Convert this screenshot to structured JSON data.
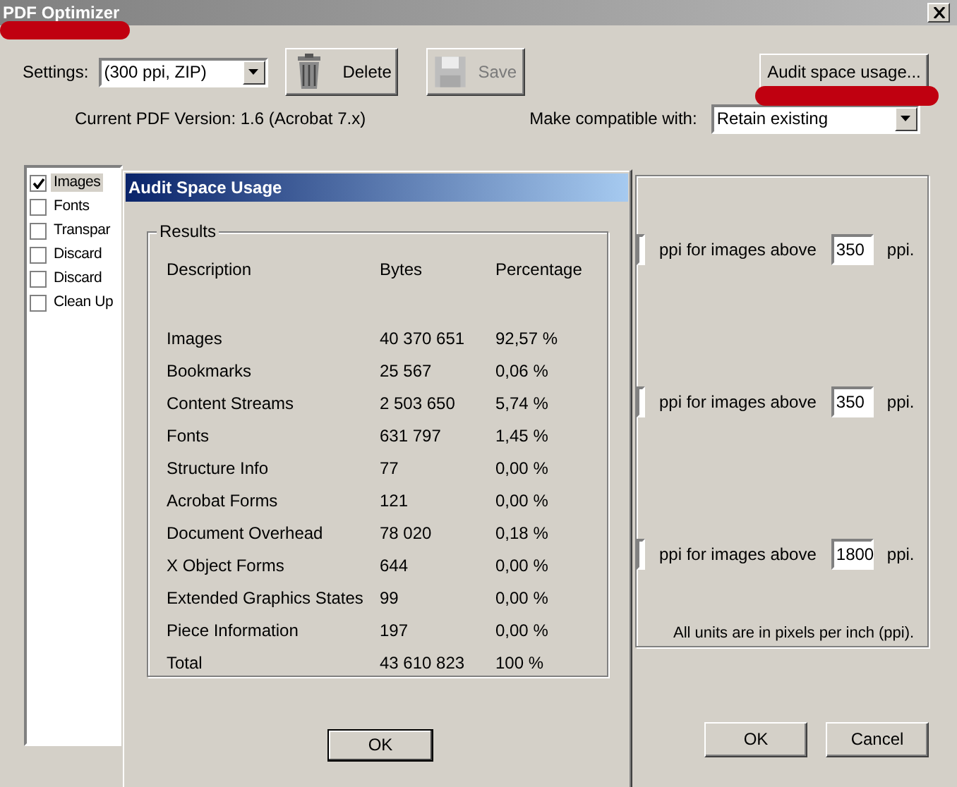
{
  "window": {
    "title": "PDF Optimizer"
  },
  "settings": {
    "label": "Settings:",
    "value": "(300 ppi, ZIP)"
  },
  "toolbar": [
    {
      "kind": "delete",
      "label": "Delete",
      "disabled": false
    },
    {
      "kind": "save",
      "label": "Save",
      "disabled": true
    }
  ],
  "audit_button": "Audit space usage...",
  "version": "Current PDF Version: 1.6 (Acrobat 7.x)",
  "compat": {
    "label": "Make compatible with:",
    "value": "Retain existing"
  },
  "panels": [
    {
      "label": "Images",
      "checked": true,
      "selected": true
    },
    {
      "label": "Fonts",
      "checked": false,
      "selected": false
    },
    {
      "label": "Transpar",
      "checked": false,
      "selected": false
    },
    {
      "label": "Discard",
      "checked": false,
      "selected": false
    },
    {
      "label": "Discard",
      "checked": false,
      "selected": false
    },
    {
      "label": "Clean Up",
      "checked": false,
      "selected": false
    }
  ],
  "image_rows": [
    {
      "text": "ppi for images above",
      "threshold": "350",
      "unit": "ppi."
    },
    {
      "text": "ppi for images above",
      "threshold": "350",
      "unit": "ppi."
    },
    {
      "text": "ppi for images above",
      "threshold": "1800",
      "unit": "ppi."
    }
  ],
  "note": "All units are in pixels per inch (ppi).",
  "footer_buttons": [
    "OK",
    "Cancel"
  ],
  "audit_dialog": {
    "title": "Audit Space Usage",
    "group": "Results",
    "columns": [
      "Description",
      "Bytes",
      "Percentage"
    ],
    "rows": [
      [
        "Images",
        "40 370 651",
        "92,57 %"
      ],
      [
        "Bookmarks",
        "25 567",
        "0,06 %"
      ],
      [
        "Content Streams",
        "2 503 650",
        "5,74 %"
      ],
      [
        "Fonts",
        "631 797",
        "1,45 %"
      ],
      [
        "Structure Info",
        "77",
        "0,00 %"
      ],
      [
        "Acrobat Forms",
        "121",
        "0,00 %"
      ],
      [
        "Document Overhead",
        "78 020",
        "0,18 %"
      ],
      [
        "X Object Forms",
        "644",
        "0,00 %"
      ],
      [
        "Extended Graphics States",
        "99",
        "0,00 %"
      ],
      [
        "Piece Information",
        "197",
        "0,00 %"
      ],
      [
        "Total",
        "43 610 823",
        "100 %"
      ]
    ],
    "button": "OK"
  }
}
